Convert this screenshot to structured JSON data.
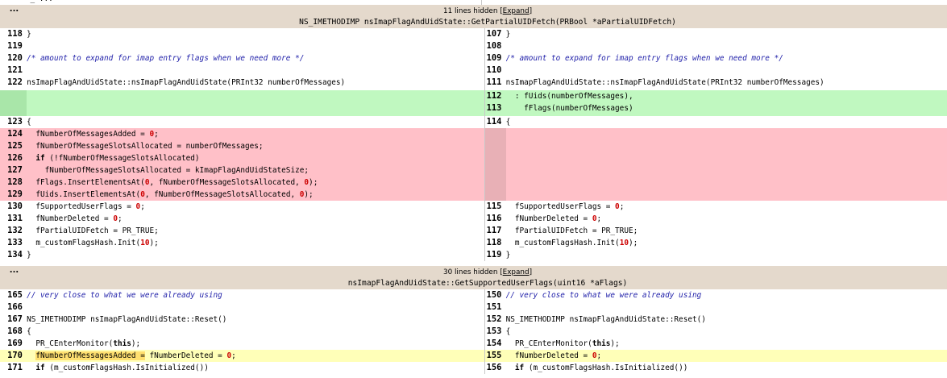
{
  "top_fragment": "_ ...",
  "hunks": [
    {
      "hidden_label": "11 lines hidden [",
      "expand_label": "Expand",
      "hidden_suffix": "]",
      "function": "NS_IMETHODIMP nsImapFlagAndUidState::GetPartialUIDFetch(PRBool *aPartialUIDFetch)"
    },
    {
      "hidden_label": "30 lines hidden [",
      "expand_label": "Expand",
      "hidden_suffix": "]",
      "function": "nsImapFlagAndUidState::GetSupportedUserFlags(uint16 *aFlags)"
    }
  ],
  "dots": "...",
  "rows": [
    {
      "type": "plain",
      "l": "118",
      "lt": "}",
      "r": "107",
      "rt": "}"
    },
    {
      "type": "plain",
      "l": "119",
      "lt": "",
      "r": "108",
      "rt": ""
    },
    {
      "type": "plain",
      "l": "120",
      "lt": "/* amount to expand for imap entry flags when we need more */",
      "r": "109",
      "rt": "/* amount to expand for imap entry flags when we need more */"
    },
    {
      "type": "plain",
      "l": "121",
      "lt": "",
      "r": "110",
      "rt": ""
    },
    {
      "type": "plain",
      "l": "122",
      "lt": "nsImapFlagAndUidState::nsImapFlagAndUidState(PRInt32 numberOfMessages)",
      "r": "111",
      "rt": "nsImapFlagAndUidState::nsImapFlagAndUidState(PRInt32 numberOfMessages)"
    },
    {
      "type": "added",
      "l": "",
      "lt": "",
      "r": "112",
      "rt": "  : fUids(numberOfMessages),"
    },
    {
      "type": "added",
      "l": "",
      "lt": "",
      "r": "113",
      "rt": "    fFlags(numberOfMessages)"
    },
    {
      "type": "plain",
      "l": "123",
      "lt": "{",
      "r": "114",
      "rt": "{"
    },
    {
      "type": "removed",
      "l": "124",
      "lt": "  fNumberOfMessagesAdded = 0;",
      "r": "",
      "rt": ""
    },
    {
      "type": "removed",
      "l": "125",
      "lt": "  fNumberOfMessageSlotsAllocated = numberOfMessages;",
      "r": "",
      "rt": ""
    },
    {
      "type": "removed",
      "l": "126",
      "lt": "  if (!fNumberOfMessageSlotsAllocated)",
      "r": "",
      "rt": ""
    },
    {
      "type": "removed",
      "l": "127",
      "lt": "    fNumberOfMessageSlotsAllocated = kImapFlagAndUidStateSize;",
      "r": "",
      "rt": ""
    },
    {
      "type": "removed",
      "l": "128",
      "lt": "  fFlags.InsertElementsAt(0, fNumberOfMessageSlotsAllocated, 0);",
      "r": "",
      "rt": ""
    },
    {
      "type": "removed",
      "l": "129",
      "lt": "  fUids.InsertElementsAt(0, fNumberOfMessageSlotsAllocated, 0);",
      "r": "",
      "rt": ""
    },
    {
      "type": "plain",
      "l": "130",
      "lt": "  fSupportedUserFlags = 0;",
      "r": "115",
      "rt": "  fSupportedUserFlags = 0;"
    },
    {
      "type": "plain",
      "l": "131",
      "lt": "  fNumberDeleted = 0;",
      "r": "116",
      "rt": "  fNumberDeleted = 0;"
    },
    {
      "type": "plain",
      "l": "132",
      "lt": "  fPartialUIDFetch = PR_TRUE;",
      "r": "117",
      "rt": "  fPartialUIDFetch = PR_TRUE;"
    },
    {
      "type": "plain",
      "l": "133",
      "lt": "  m_customFlagsHash.Init(10);",
      "r": "118",
      "rt": "  m_customFlagsHash.Init(10);"
    },
    {
      "type": "plain",
      "l": "134",
      "lt": "}",
      "r": "119",
      "rt": "}"
    },
    {
      "type": "plain",
      "l": "165",
      "lt": "// very close to what we were already using",
      "r": "150",
      "rt": "// very close to what we were already using"
    },
    {
      "type": "plain",
      "l": "166",
      "lt": "",
      "r": "151",
      "rt": ""
    },
    {
      "type": "plain",
      "l": "167",
      "lt": "NS_IMETHODIMP nsImapFlagAndUidState::Reset()",
      "r": "152",
      "rt": "NS_IMETHODIMP nsImapFlagAndUidState::Reset()"
    },
    {
      "type": "plain",
      "l": "168",
      "lt": "{",
      "r": "153",
      "rt": "{"
    },
    {
      "type": "plain",
      "l": "169",
      "lt": "  PR_CEnterMonitor(this);",
      "r": "154",
      "rt": "  PR_CEnterMonitor(this);"
    },
    {
      "type": "changed",
      "l": "170",
      "lt": "  fNumberOfMessagesAdded = fNumberDeleted = 0;",
      "r": "155",
      "rt": "  fNumberDeleted = 0;"
    },
    {
      "type": "plain",
      "l": "171",
      "lt": "  if (m_customFlagsHash.IsInitialized())",
      "r": "156",
      "rt": "  if (m_customFlagsHash.IsInitialized())"
    }
  ]
}
